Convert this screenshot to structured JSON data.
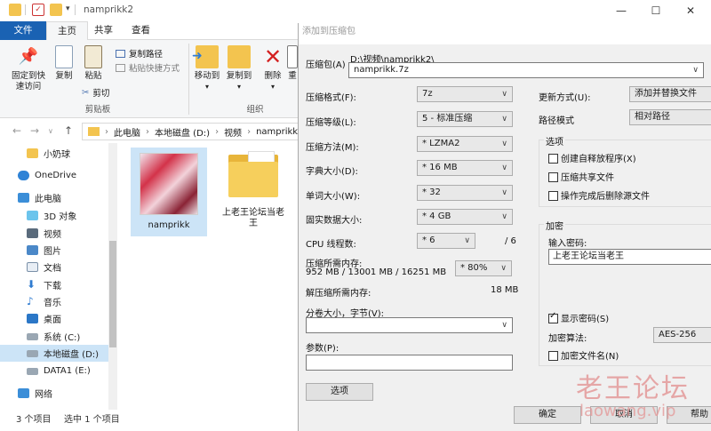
{
  "explorer": {
    "title": "namprikk2",
    "tabs": [
      "文件",
      "主页",
      "共享",
      "查看"
    ],
    "ribbon": {
      "pin_label": "固定到快\n速访问",
      "copy_label": "复制",
      "paste_label": "粘贴",
      "copy_path_label": "复制路径",
      "paste_shortcut_label": "粘贴快捷方式",
      "cut_label": "剪切",
      "clipboard_group": "剪贴板",
      "move_to_label": "移动到",
      "copy_to_label": "复制到",
      "delete_label": "删除",
      "rename_label": "重",
      "organize_group": "组织"
    },
    "breadcrumb": [
      "此电脑",
      "本地磁盘 (D:)",
      "视频",
      "namprikk"
    ],
    "sidebar": [
      {
        "label": "小奶球",
        "icon": "folder-icon"
      },
      {
        "label": "OneDrive",
        "icon": "cloud-icon"
      },
      {
        "label": "此电脑",
        "icon": "computer-icon"
      },
      {
        "label": "3D 对象",
        "icon": "cube-icon"
      },
      {
        "label": "视频",
        "icon": "video-icon"
      },
      {
        "label": "图片",
        "icon": "picture-icon"
      },
      {
        "label": "文档",
        "icon": "document-icon"
      },
      {
        "label": "下载",
        "icon": "download-icon"
      },
      {
        "label": "音乐",
        "icon": "music-icon"
      },
      {
        "label": "桌面",
        "icon": "desktop-icon"
      },
      {
        "label": "系统 (C:)",
        "icon": "drive-icon"
      },
      {
        "label": "本地磁盘 (D:)",
        "icon": "drive-icon"
      },
      {
        "label": "DATA1 (E:)",
        "icon": "drive-icon"
      },
      {
        "label": "网络",
        "icon": "network-icon"
      }
    ],
    "files": [
      {
        "name": "namprikk"
      },
      {
        "name": "上老王论坛当老\n王"
      }
    ],
    "status_count": "3 个项目",
    "status_selected": "选中 1 个项目"
  },
  "dialog": {
    "title": "添加到压缩包",
    "archive_label": "压缩包(A)",
    "archive_path": "D:\\视频\\namprikk2\\",
    "archive_name": "namprikk.7z",
    "format_label": "压缩格式(F):",
    "format_value": "7z",
    "level_label": "压缩等级(L):",
    "level_value": "5 - 标准压缩",
    "method_label": "压缩方法(M):",
    "method_value": "* LZMA2",
    "dict_label": "字典大小(D):",
    "dict_value": "* 16 MB",
    "word_label": "单词大小(W):",
    "word_value": "* 32",
    "solid_label": "固实数据大小:",
    "solid_value": "* 4 GB",
    "cpu_label": "CPU 线程数:",
    "cpu_value": "* 6",
    "cpu_max": "/ 6",
    "mem_label": "压缩所需内存:",
    "mem_detail": "952 MB / 13001 MB / 16251 MB",
    "mem_percent": "* 80%",
    "decomp_label": "解压缩所需内存:",
    "decomp_value": "18 MB",
    "volume_label": "分卷大小，字节(V):",
    "params_label": "参数(P):",
    "options_button": "选项",
    "update_label": "更新方式(U):",
    "update_value": "添加并替换文件",
    "pathmode_label": "路径模式",
    "pathmode_value": "相对路径",
    "options_group": "选项",
    "opt_sfx": "创建自释放程序(X)",
    "opt_shared": "压缩共享文件",
    "opt_delete": "操作完成后删除源文件",
    "encrypt_group": "加密",
    "password_label": "输入密码:",
    "password_value": "上老王论坛当老王",
    "show_password": "显示密码(S)",
    "enc_method_label": "加密算法:",
    "enc_method_value": "AES-256",
    "enc_names": "加密文件名(N)",
    "ok_button": "确定",
    "cancel_button": "取消",
    "help_button": "帮助"
  },
  "watermark": {
    "cn": "老王论坛",
    "url": "laowang.vip"
  }
}
